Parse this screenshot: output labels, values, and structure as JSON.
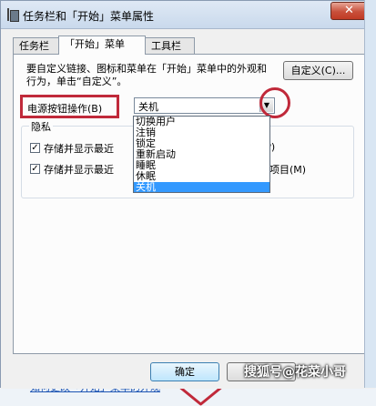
{
  "window": {
    "title": "任务栏和「开始」菜单属性",
    "close_label": "✕"
  },
  "tabs": [
    {
      "label": "任务栏",
      "active": false
    },
    {
      "label": "「开始」菜单",
      "active": true
    },
    {
      "label": "工具栏",
      "active": false
    }
  ],
  "panel": {
    "description": "要自定义链接、图标和菜单在「开始」菜单中的外观和行为，单击“自定义”。",
    "customize_label": "自定义(C)...",
    "power_label": "电源按钮操作(B)",
    "power_value": "关机",
    "privacy_title": "隐私",
    "check1_label": "存储并显示最近",
    "check1_suffix": "(P)",
    "check2_label": "存储并显示最近",
    "check2_suffix": "开的项目(M)",
    "link": "如何更改「开始」菜单的外观"
  },
  "dropdown": {
    "options": [
      "切换用户",
      "注销",
      "锁定",
      "重新启动",
      "睡眠",
      "休眠",
      "关机"
    ],
    "selected": "关机"
  },
  "buttons": {
    "ok_label": "确定",
    "cancel_label": ""
  },
  "watermark": "搜狐号@花菜小哥",
  "colors": {
    "annotation_red": "#c0293a",
    "selection_blue": "#3399ff",
    "link_blue": "#1e55b3"
  }
}
